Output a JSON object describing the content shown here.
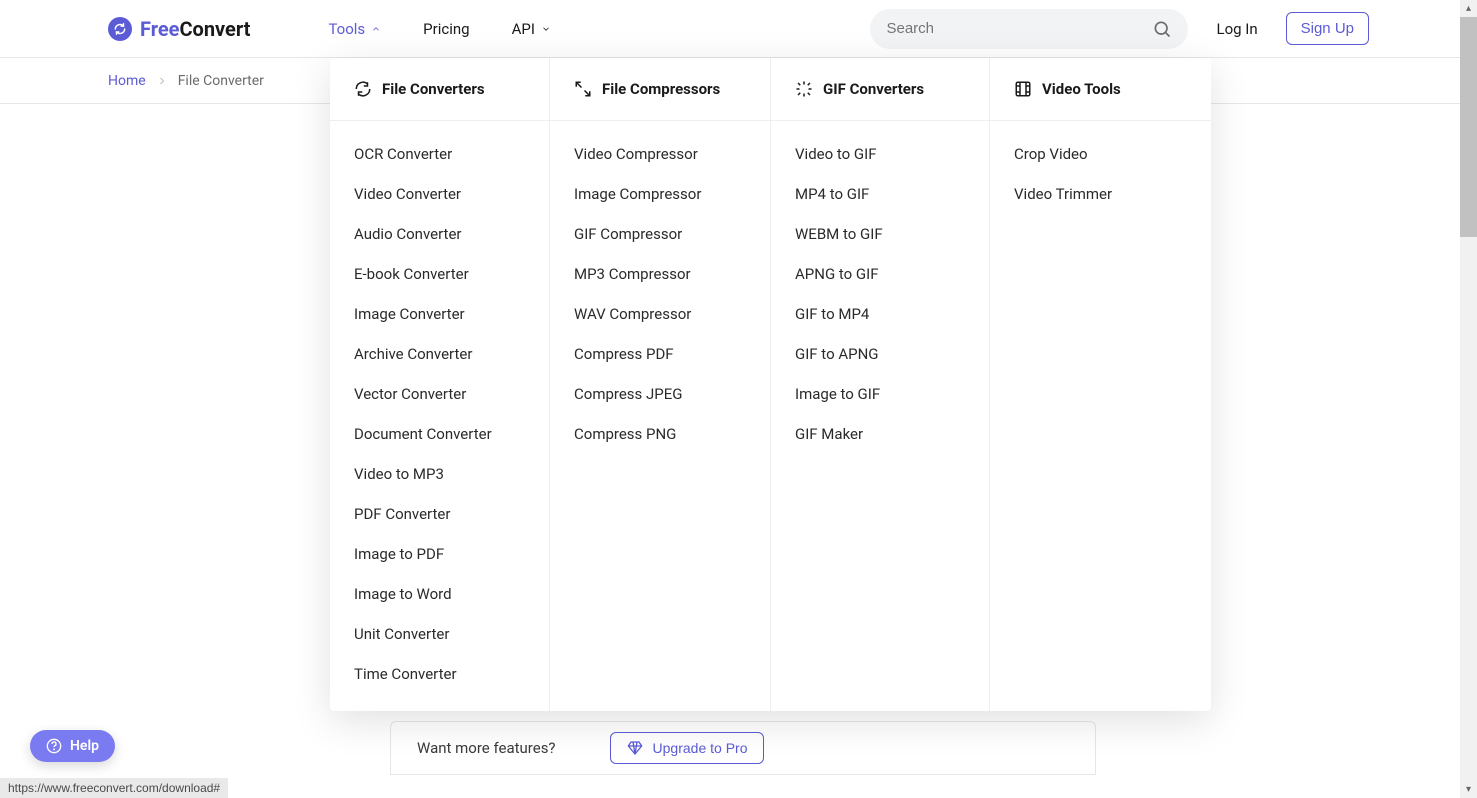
{
  "brand": {
    "free": "Free",
    "convert": "Convert"
  },
  "nav": {
    "tools": "Tools",
    "pricing": "Pricing",
    "api": "API"
  },
  "search": {
    "placeholder": "Search"
  },
  "auth": {
    "login": "Log In",
    "signup": "Sign Up"
  },
  "breadcrumb": {
    "home": "Home",
    "current": "File Converter"
  },
  "mega": {
    "col1": {
      "title": "File Converters",
      "items": [
        "OCR Converter",
        "Video Converter",
        "Audio Converter",
        "E-book Converter",
        "Image Converter",
        "Archive Converter",
        "Vector Converter",
        "Document Converter",
        "Video to MP3",
        "PDF Converter",
        "Image to PDF",
        "Image to Word",
        "Unit Converter",
        "Time Converter"
      ]
    },
    "col2": {
      "title": "File Compressors",
      "items": [
        "Video Compressor",
        "Image Compressor",
        "GIF Compressor",
        "MP3 Compressor",
        "WAV Compressor",
        "Compress PDF",
        "Compress JPEG",
        "Compress PNG"
      ]
    },
    "col3": {
      "title": "GIF Converters",
      "items": [
        "Video to GIF",
        "MP4 to GIF",
        "WEBM to GIF",
        "APNG to GIF",
        "GIF to MP4",
        "GIF to APNG",
        "Image to GIF",
        "GIF Maker"
      ]
    },
    "col4": {
      "title": "Video Tools",
      "items": [
        "Crop Video",
        "Video Trimmer"
      ]
    }
  },
  "upgrade": {
    "question": "Want more features?",
    "button": "Upgrade to Pro"
  },
  "help": {
    "label": "Help"
  },
  "status_url": "https://www.freeconvert.com/download#"
}
